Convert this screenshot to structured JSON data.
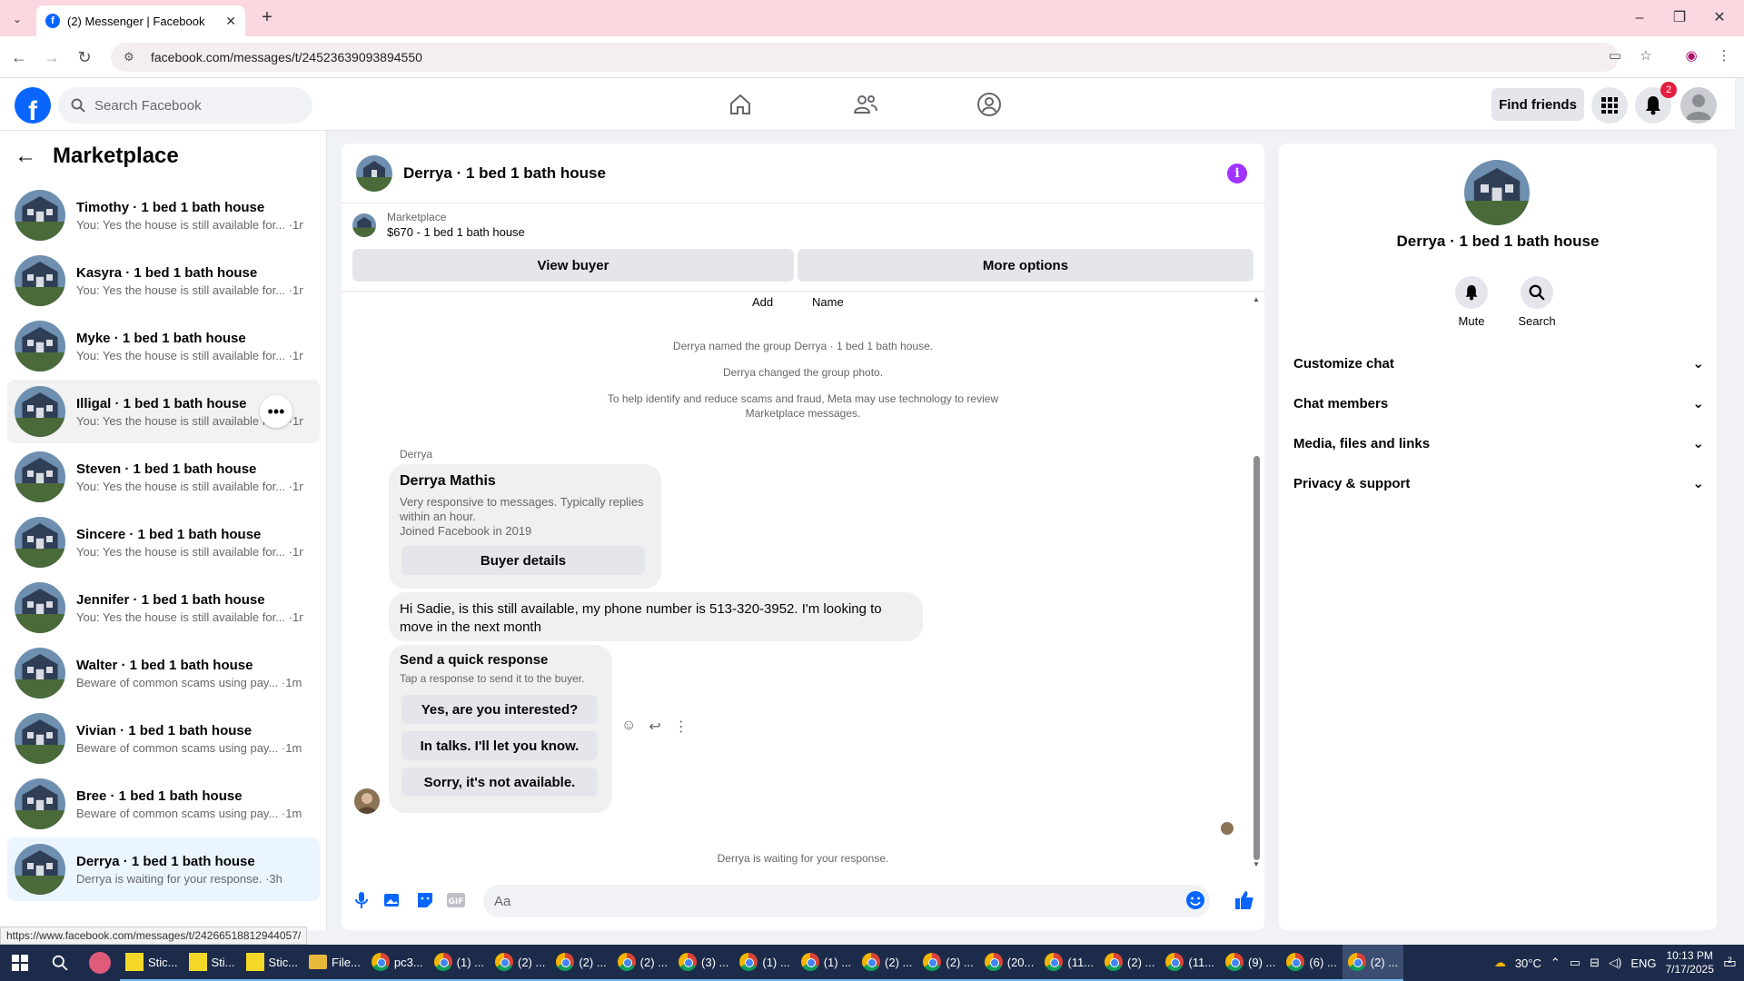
{
  "browser": {
    "tab_title": "(2) Messenger | Facebook",
    "url": "facebook.com/messages/t/24523639093894550",
    "status_url": "https://www.facebook.com/messages/t/24266518812944057/"
  },
  "fb": {
    "search_placeholder": "Search Facebook",
    "find_friends": "Find friends",
    "notification_count": "2",
    "brand_color": "#0866ff"
  },
  "sidebar": {
    "title": "Marketplace",
    "conversations": [
      {
        "name": "Timothy · 1 bed 1 bath house",
        "preview": "You: Yes the house is still available for... ·1m"
      },
      {
        "name": "Kasyra · 1 bed 1 bath house",
        "preview": "You: Yes the house is still available for... ·1m"
      },
      {
        "name": "Myke · 1 bed 1 bath house",
        "preview": "You: Yes the house is still available for... ·1m"
      },
      {
        "name": "Illigal · 1 bed 1 bath house",
        "preview": "You: Yes the house is still available for... ·1m"
      },
      {
        "name": "Steven · 1 bed 1 bath house",
        "preview": "You: Yes the house is still available for... ·1m"
      },
      {
        "name": "Sincere · 1 bed 1 bath house",
        "preview": "You: Yes the house is still available for... ·1m"
      },
      {
        "name": "Jennifer · 1 bed 1 bath house",
        "preview": "You: Yes the house is still available for... ·1m"
      },
      {
        "name": "Walter · 1 bed 1 bath house",
        "preview": "Beware of common scams using pay... ·1m"
      },
      {
        "name": "Vivian · 1 bed 1 bath house",
        "preview": "Beware of common scams using pay... ·1m"
      },
      {
        "name": "Bree · 1 bed 1 bath house",
        "preview": "Beware of common scams using pay... ·1m"
      },
      {
        "name": "Derrya · 1 bed 1 bath house",
        "preview": "Derrya is waiting for your response. ·3h"
      }
    ]
  },
  "chat": {
    "title": "Derrya · 1 bed 1 bath house",
    "marketplace_label": "Marketplace",
    "listing": "$670 - 1 bed 1 bath house",
    "view_buyer": "View buyer",
    "more_options": "More options",
    "add_label": "Add",
    "name_label": "Name",
    "sys1": "Derrya named the group Derrya · 1 bed 1 bath house.",
    "sys2": "Derrya changed the group photo.",
    "sys3a": "To help identify and reduce scams and fraud, Meta may use technology to review",
    "sys3b": "Marketplace messages.",
    "sender": "Derrya",
    "card_name": "Derrya Mathis",
    "card_line1": "Very responsive to messages. Typically replies",
    "card_line2": "within an hour.",
    "card_line3": "Joined Facebook in 2019",
    "buyer_details": "Buyer details",
    "message_line1": "Hi Sadie, is this still available, my phone number is 513-320-3952. I'm looking to",
    "message_line2": "move in the next month",
    "quick_title": "Send a quick response",
    "quick_sub": "Tap a response to send it to the buyer.",
    "quick1": "Yes, are you interested?",
    "quick2": "In talks. I'll let you know.",
    "quick3": "Sorry, it's not available.",
    "waiting": "Derrya is waiting for your response.",
    "composer_placeholder": "Aa"
  },
  "right": {
    "title": "Derrya · 1 bed 1 bath house",
    "mute": "Mute",
    "search": "Search",
    "sections": [
      "Customize chat",
      "Chat members",
      "Media, files and links",
      "Privacy & support"
    ]
  },
  "taskbar": {
    "items": [
      {
        "icon": "sticky",
        "label": "Stic..."
      },
      {
        "icon": "sticky",
        "label": "Sti..."
      },
      {
        "icon": "sticky",
        "label": "Stic..."
      },
      {
        "icon": "folder",
        "label": "File..."
      },
      {
        "icon": "chrome",
        "label": "pc3..."
      },
      {
        "icon": "chrome",
        "label": "(1) ..."
      },
      {
        "icon": "chrome",
        "label": "(2) ..."
      },
      {
        "icon": "chrome",
        "label": "(2) ..."
      },
      {
        "icon": "chrome",
        "label": "(2) ..."
      },
      {
        "icon": "chrome",
        "label": "(3) ..."
      },
      {
        "icon": "chrome",
        "label": "(1) ..."
      },
      {
        "icon": "chrome",
        "label": "(1) ..."
      },
      {
        "icon": "chrome",
        "label": "(2) ..."
      },
      {
        "icon": "chrome",
        "label": "(2) ..."
      },
      {
        "icon": "chrome",
        "label": "(20..."
      },
      {
        "icon": "chrome",
        "label": "(11..."
      },
      {
        "icon": "chrome",
        "label": "(2) ..."
      },
      {
        "icon": "chrome",
        "label": "(11..."
      },
      {
        "icon": "chrome",
        "label": "(9) ..."
      },
      {
        "icon": "chrome",
        "label": "(6) ..."
      },
      {
        "icon": "chrome",
        "label": "(2) ..."
      }
    ],
    "weather": "30°C",
    "lang": "ENG",
    "time": "10:13 PM",
    "date": "7/17/2025",
    "notif": "2"
  }
}
